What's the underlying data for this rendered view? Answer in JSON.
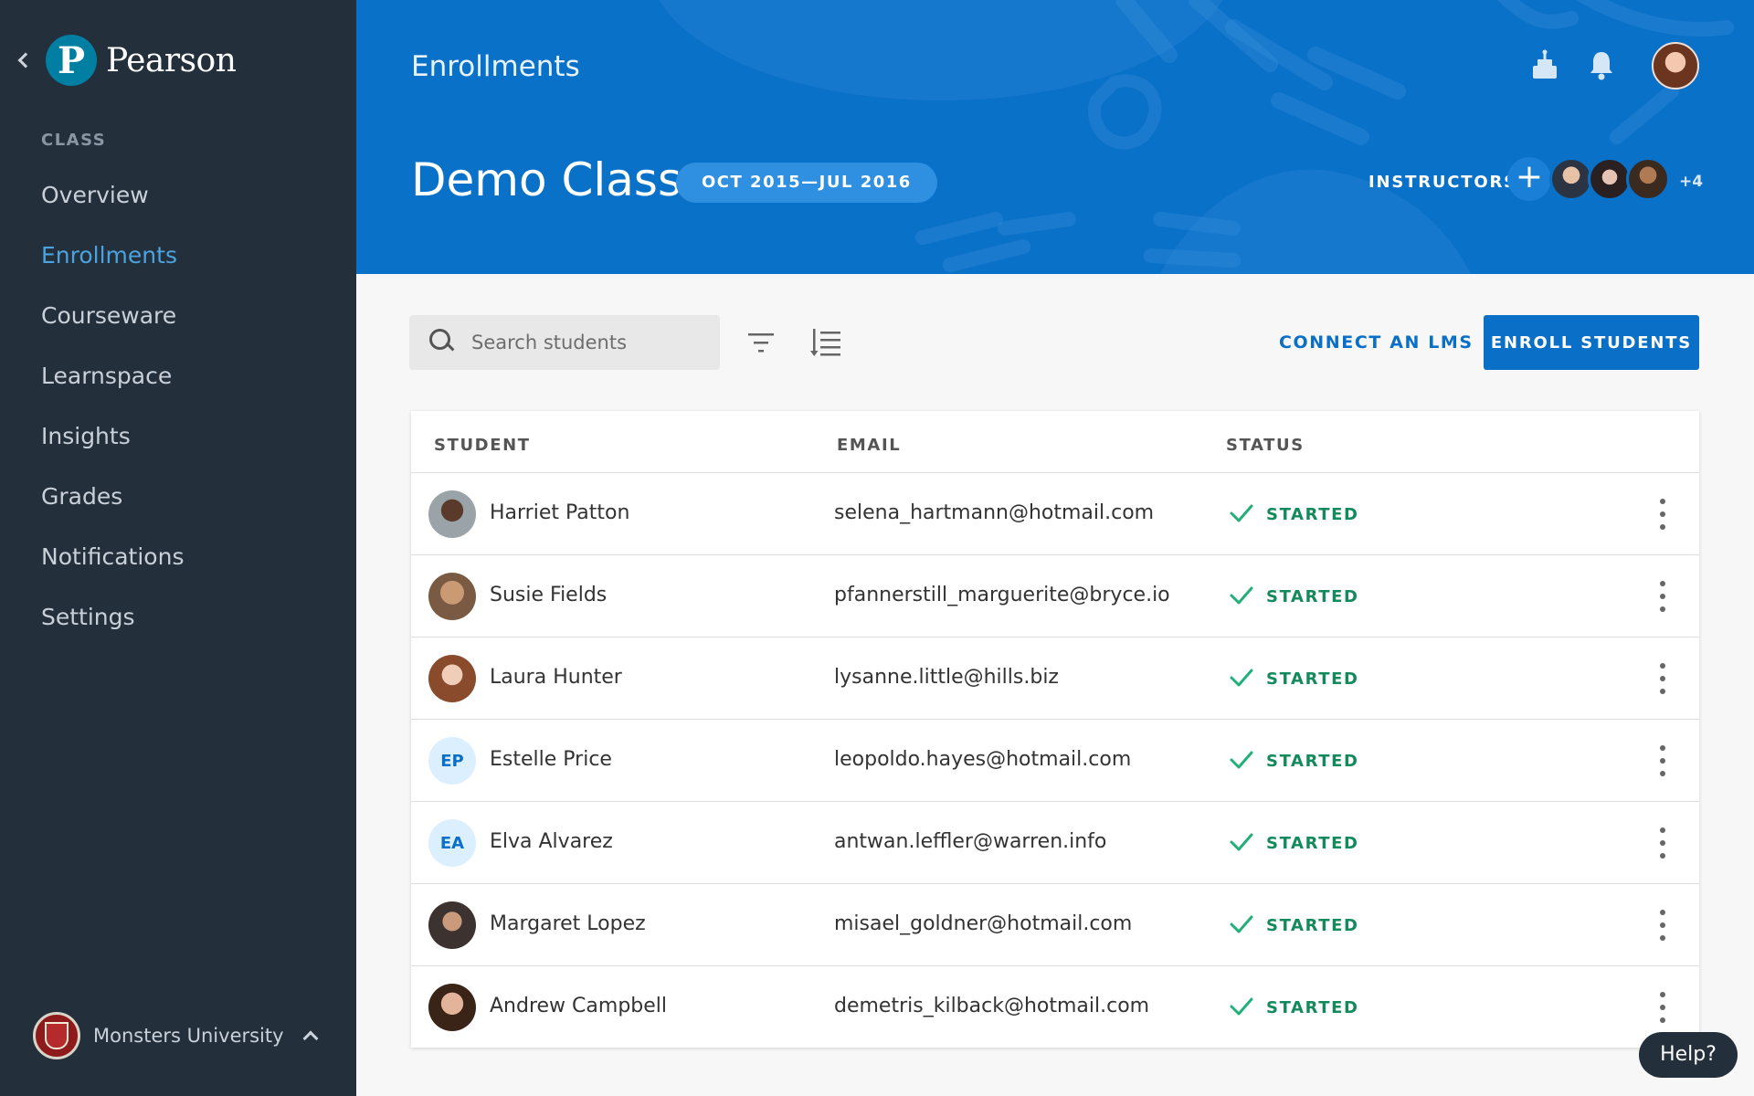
{
  "brand": {
    "name": "Pearson",
    "logo_letter": "P"
  },
  "sidebar": {
    "section_label": "CLASS",
    "items": [
      {
        "label": "Overview",
        "active": false
      },
      {
        "label": "Enrollments",
        "active": true
      },
      {
        "label": "Courseware",
        "active": false
      },
      {
        "label": "Learnspace",
        "active": false
      },
      {
        "label": "Insights",
        "active": false
      },
      {
        "label": "Grades",
        "active": false
      },
      {
        "label": "Notifications",
        "active": false
      },
      {
        "label": "Settings",
        "active": false
      }
    ],
    "org": {
      "name": "Monsters University"
    }
  },
  "header": {
    "breadcrumb": "Enrollments",
    "class_title": "Demo Class",
    "date_range": "OCT 2015—JUL 2016",
    "instructors_label": "INSTRUCTORS",
    "add_instructor": "+",
    "instructors_more": "+4"
  },
  "toolbar": {
    "search_placeholder": "Search students",
    "connect_lms": "CONNECT AN LMS",
    "enroll_students": "ENROLL STUDENTS"
  },
  "table": {
    "columns": [
      "STUDENT",
      "EMAIL",
      "STATUS"
    ],
    "rows": [
      {
        "name": "Harriet Patton",
        "email": "selena_hartmann@hotmail.com",
        "status": "STARTED",
        "initials": ""
      },
      {
        "name": "Susie Fields",
        "email": "pfannerstill_marguerite@bryce.io",
        "status": "STARTED",
        "initials": ""
      },
      {
        "name": "Laura Hunter",
        "email": "lysanne.little@hills.biz",
        "status": "STARTED",
        "initials": ""
      },
      {
        "name": "Estelle Price",
        "email": "leopoldo.hayes@hotmail.com",
        "status": "STARTED",
        "initials": "EP"
      },
      {
        "name": "Elva Alvarez",
        "email": "antwan.leffler@warren.info",
        "status": "STARTED",
        "initials": "EA"
      },
      {
        "name": "Margaret Lopez",
        "email": "misael_goldner@hotmail.com",
        "status": "STARTED",
        "initials": ""
      },
      {
        "name": "Andrew Campbell",
        "email": "demetris_kilback@hotmail.com",
        "status": "STARTED",
        "initials": ""
      }
    ]
  },
  "help_label": "Help?",
  "colors": {
    "sidebar_bg": "#232f3b",
    "header_bg": "#0a71c8",
    "accent": "#0a6fc7",
    "active_nav": "#4aa3df",
    "status_started": "#128a5c"
  }
}
